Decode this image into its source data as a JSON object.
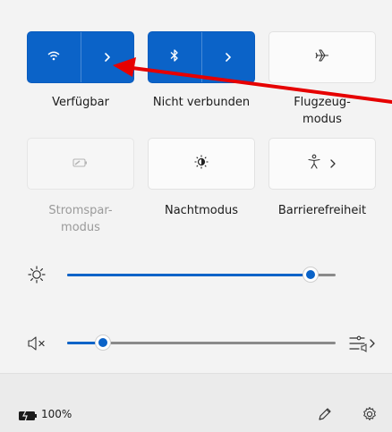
{
  "tiles": {
    "wifi": {
      "label": "Verfügbar",
      "icon": "wifi-icon",
      "expand": "chevron-right-icon"
    },
    "bluetooth": {
      "label": "Nicht verbunden",
      "icon": "bluetooth-icon",
      "expand": "chevron-right-icon"
    },
    "airplane": {
      "label_line1": "Flugzeug-",
      "label_line2": "modus",
      "icon": "airplane-icon"
    },
    "battery_saver": {
      "label_line1": "Stromspar-",
      "label_line2": "modus",
      "icon": "battery-saver-icon"
    },
    "night_light": {
      "label": "Nachtmodus",
      "icon": "night-light-icon"
    },
    "accessibility": {
      "label": "Barrierefreiheit",
      "icon": "accessibility-icon",
      "expand": "chevron-right-icon"
    }
  },
  "sliders": {
    "brightness": {
      "icon": "brightness-icon",
      "value": 0.9
    },
    "volume": {
      "icon": "volume-muted-icon",
      "value": 0.12,
      "output": "audio-output-icon"
    }
  },
  "status": {
    "battery": "100%",
    "battery_icon": "battery-charging-icon",
    "edit_icon": "pencil-icon",
    "settings_icon": "gear-icon"
  },
  "colors": {
    "accent": "#0b63c8",
    "annotation_arrow": "#e60000"
  }
}
